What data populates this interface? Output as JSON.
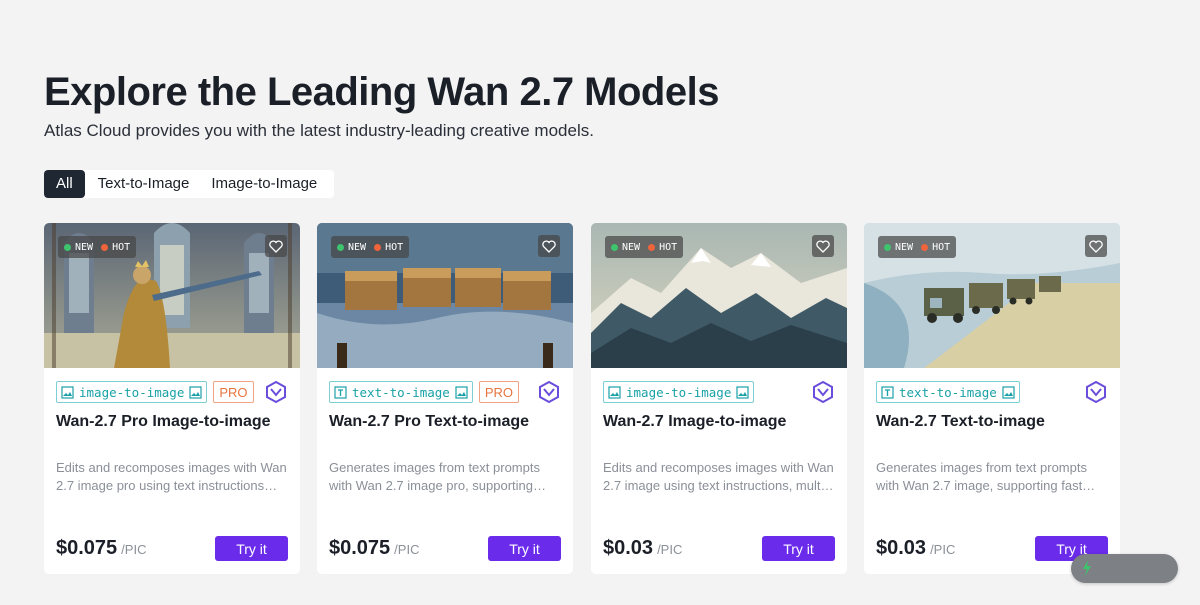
{
  "header": {
    "title": "Explore the Leading Wan 2.7 Models",
    "subtitle": "Atlas Cloud provides you with the latest industry-leading creative models."
  },
  "filters": {
    "tabs": [
      "All",
      "Text-to-Image",
      "Image-to-Image"
    ],
    "active": "All"
  },
  "badges": {
    "new": "NEW",
    "hot": "HOT"
  },
  "colors": {
    "accent": "#6a2bea",
    "new_dot": "#3ec46d",
    "hot_dot": "#f0643c",
    "tag": "#1aa1a8",
    "pro": "#e6743f"
  },
  "cards": [
    {
      "tag": "image-to-image",
      "pro": "PRO",
      "title": "Wan-2.7 Pro Image-to-image",
      "desc_line1": "Edits and recomposes images with Wan",
      "desc_line2": "2.7 image pro using text instructions…",
      "price": "$0.075",
      "unit": "/PIC",
      "cta": "Try it",
      "image": "knight-in-cathedral"
    },
    {
      "tag": "text-to-image",
      "pro": "PRO",
      "title": "Wan-2.7 Pro Text-to-image",
      "desc_line1": "Generates images from text prompts",
      "desc_line2": "with Wan 2.7 image pro, supporting…",
      "price": "$0.075",
      "unit": "/PIC",
      "cta": "Try it",
      "image": "wooden-boxes-on-table"
    },
    {
      "tag": "image-to-image",
      "title": "Wan-2.7 Image-to-image",
      "desc_line1": "Edits and recomposes images with Wan",
      "desc_line2": "2.7 image using text instructions, multi…",
      "price": "$0.03",
      "unit": "/PIC",
      "cta": "Try it",
      "image": "snowy-mountains"
    },
    {
      "tag": "text-to-image",
      "title": "Wan-2.7 Text-to-image",
      "desc_line1": "Generates images from text prompts",
      "desc_line2": "with Wan 2.7 image, supporting fast…",
      "price": "$0.03",
      "unit": "/PIC",
      "cta": "Try it",
      "image": "trucks-on-snowy-road"
    }
  ]
}
